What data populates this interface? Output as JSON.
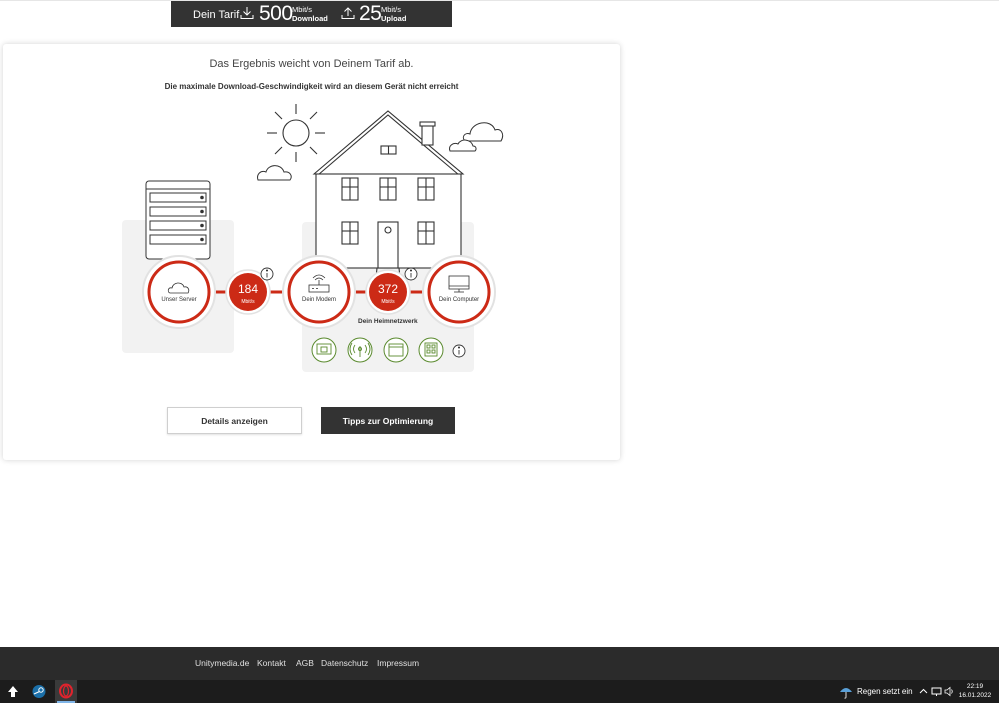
{
  "tariff": {
    "label": "Dein Tarif",
    "download_value": "500",
    "download_unit": "Mbit/s",
    "download_label": "Download",
    "upload_value": "25",
    "upload_unit": "Mbit/s",
    "upload_label": "Upload"
  },
  "result": {
    "title": "Das Ergebnis weicht von Deinem Tarif ab.",
    "subtitle": "Die maximale Download-Geschwindigkeit wird an diesem Gerät nicht erreicht"
  },
  "path": {
    "server_label": "Unser Server",
    "modem_label": "Dein Modem",
    "computer_label": "Dein Computer",
    "speed1_value": "184",
    "speed1_unit": "Mbit/s",
    "speed2_value": "372",
    "speed2_unit": "Mbit/s",
    "home_network_label": "Dein Heimnetzwerk"
  },
  "buttons": {
    "details": "Details anzeigen",
    "tips": "Tipps zur Optimierung"
  },
  "footer": {
    "links": [
      "Unitymedia.de",
      "Kontakt",
      "AGB",
      "Datenschutz",
      "Impressum"
    ]
  },
  "taskbar": {
    "weather": "Regen setzt ein",
    "time": "22:19",
    "date": "16.01.2022"
  },
  "colors": {
    "accent_red": "#cc2a16",
    "dark": "#333333",
    "network_green": "#5a8a2e"
  }
}
